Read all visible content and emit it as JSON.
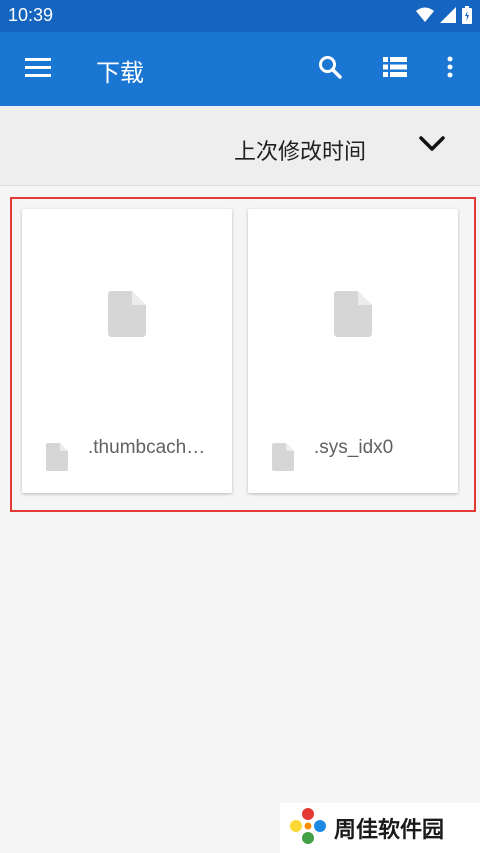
{
  "status_bar": {
    "time": "10:39",
    "icons": [
      "wifi-icon",
      "signal-icon",
      "battery-icon"
    ]
  },
  "app_bar": {
    "title": "下载",
    "icons": [
      "menu-icon",
      "search-icon",
      "list-view-icon",
      "more-vert-icon"
    ],
    "color": "#1976d2"
  },
  "sort": {
    "label": "上次修改时间"
  },
  "files": [
    {
      "name": ".thumbcach…",
      "icon": "file-icon"
    },
    {
      "name": ".sys_idx0",
      "icon": "file-icon"
    }
  ],
  "watermark": {
    "text": "周佳软件园"
  },
  "colors": {
    "status_bar": "#1565c0",
    "highlight_border": "#e53935"
  }
}
